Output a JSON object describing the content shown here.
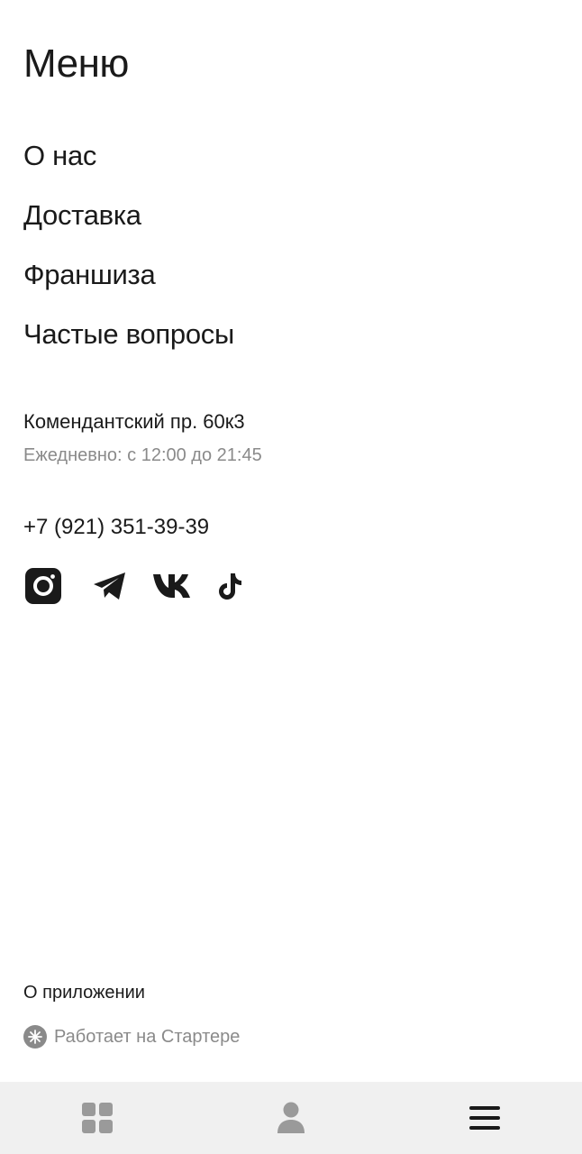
{
  "header": {
    "title": "Меню"
  },
  "nav": {
    "items": [
      {
        "label": "О нас"
      },
      {
        "label": "Доставка"
      },
      {
        "label": "Франшиза"
      },
      {
        "label": "Частые вопросы"
      }
    ]
  },
  "contacts": {
    "address": "Комендантский пр. 60к3",
    "hours": "Ежедневно: с 12:00 до 21:45",
    "phone": "+7 (921) 351-39-39"
  },
  "socials": [
    "instagram-icon",
    "telegram-icon",
    "vk-icon",
    "tiktok-icon"
  ],
  "footer": {
    "about_label": "О приложении",
    "powered_label": "Работает на Стартере"
  },
  "tabbar": {
    "tabs": [
      "catalog-grid-icon",
      "profile-icon",
      "menu-icon"
    ],
    "active_tab": "menu-icon"
  },
  "colors": {
    "text": "#1a1a1a",
    "muted": "#8a8a8a",
    "tabbar_bg": "#f0f0f0",
    "tab_inactive": "#9a9a9a"
  }
}
